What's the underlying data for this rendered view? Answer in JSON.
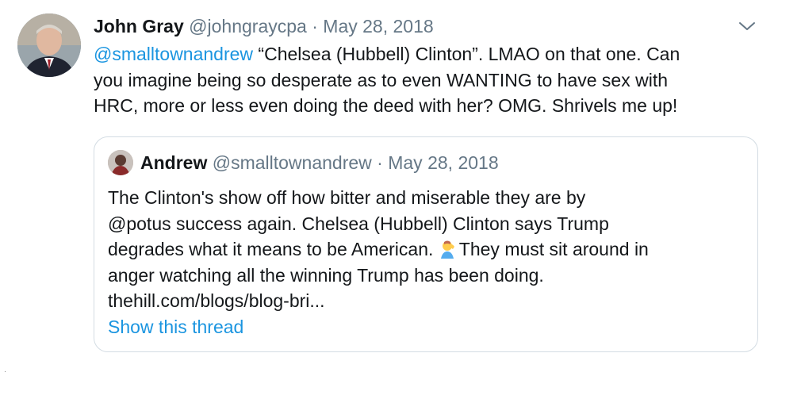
{
  "tweet": {
    "author_name": "John Gray",
    "handle": "@johngraycpa",
    "separator": " · ",
    "date": "May 28, 2018",
    "icons": {
      "avatar": "profile-photo",
      "menu": "chevron-down-icon"
    },
    "text": {
      "mention": "@smalltownandrew",
      "line1_rest": " “Chelsea (Hubbell) Clinton”. LMAO on that one. Can",
      "line2": "you imagine being so desperate as to even WANTING to have sex with",
      "line3": "HRC, more or less even doing the deed with her? OMG. Shrivels me up!"
    }
  },
  "quoted_tweet": {
    "author_name": "Andrew",
    "handle": "@smalltownandrew",
    "separator": " · ",
    "date": "May 28, 2018",
    "icons": {
      "avatar": "profile-photo",
      "emoji": "man-facepalming-emoji"
    },
    "lines": {
      "line1": "The Clinton's show off how bitter and miserable they are by",
      "line2": "@potus success again. Chelsea (Hubbell) Clinton says Trump",
      "line3a": "degrades what it means to be American.  ",
      "line3b": "They must sit around in",
      "line4": "anger watching all the  winning Trump has been doing.",
      "line5": "thehill.com/blogs/blog-bri..."
    },
    "show_thread": "Show this thread"
  },
  "colors": {
    "text": "#14171a",
    "muted": "#657786",
    "link": "#1b95e0",
    "border": "#d3dce3"
  }
}
